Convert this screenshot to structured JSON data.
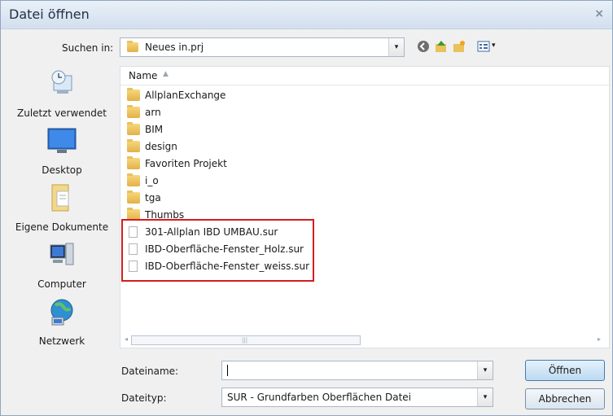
{
  "window": {
    "title": "Datei öffnen",
    "close_glyph": "×"
  },
  "lookin": {
    "label": "Suchen in:",
    "value": "Neues in.prj",
    "dropdown_glyph": "▾"
  },
  "toolbar": {
    "icons": [
      "back-icon",
      "up-folder-icon",
      "new-folder-icon",
      "view-menu-icon"
    ],
    "view_caret": "▾"
  },
  "places": [
    {
      "label": "Zuletzt verwendet",
      "icon": "recent-places-icon"
    },
    {
      "label": "Desktop",
      "icon": "desktop-icon"
    },
    {
      "label": "Eigene Dokumente",
      "icon": "documents-icon"
    },
    {
      "label": "Computer",
      "icon": "computer-icon"
    },
    {
      "label": "Netzwerk",
      "icon": "network-icon"
    }
  ],
  "list": {
    "column_name": "Name",
    "sort_glyph": "▲",
    "items": [
      {
        "name": "AllplanExchange",
        "type": "folder"
      },
      {
        "name": "arn",
        "type": "folder"
      },
      {
        "name": "BIM",
        "type": "folder"
      },
      {
        "name": "design",
        "type": "folder"
      },
      {
        "name": "Favoriten Projekt",
        "type": "folder"
      },
      {
        "name": "i_o",
        "type": "folder"
      },
      {
        "name": "tga",
        "type": "folder"
      },
      {
        "name": "Thumbs",
        "type": "folder"
      },
      {
        "name": "301-Allplan IBD UMBAU.sur",
        "type": "file"
      },
      {
        "name": "IBD-Oberfläche-Fenster_Holz.sur",
        "type": "file"
      },
      {
        "name": "IBD-Oberfläche-Fenster_weiss.sur",
        "type": "file"
      }
    ],
    "scroll_grip": "|||",
    "scroll_left": "◂",
    "scroll_right": "▸"
  },
  "filename": {
    "label": "Dateiname:",
    "value": ""
  },
  "filetype": {
    "label": "Dateityp:",
    "value": "SUR - Grundfarben Oberflächen Datei"
  },
  "buttons": {
    "open": "Öffnen",
    "cancel": "Abbrechen"
  },
  "colors": {
    "highlight": "#d41c1c",
    "folder": "#e9c15d",
    "title_bg": "#dfe8f3"
  }
}
